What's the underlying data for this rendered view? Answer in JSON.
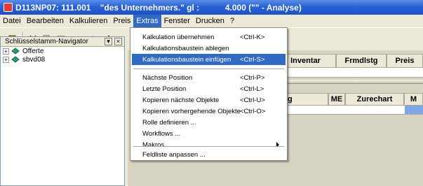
{
  "window": {
    "title": "D113NP07: 111.001    \"des Unternehmers.\" gl :           4.000 (\"\" - Analyse)"
  },
  "menubar": {
    "items": [
      {
        "label": "Datei"
      },
      {
        "label": "Bearbeiten"
      },
      {
        "label": "Kalkulieren"
      },
      {
        "label": "Preis"
      },
      {
        "label": "Extras"
      },
      {
        "label": "Fenster"
      },
      {
        "label": "Drucken"
      },
      {
        "label": "?"
      }
    ]
  },
  "navigator": {
    "title": "Schlüsselstamm-Navigator",
    "tree": [
      {
        "label": "Offerte"
      },
      {
        "label": "sbvd08"
      }
    ]
  },
  "columns_top": [
    {
      "label": "Inventar"
    },
    {
      "label": "Frmdlstg"
    },
    {
      "label": "Preis"
    }
  ],
  "columns_bottom": [
    {
      "label": "ig"
    },
    {
      "label": "ME"
    },
    {
      "label": "Zurechart"
    },
    {
      "label": "M"
    }
  ],
  "extras_menu": {
    "items": [
      {
        "label": "Kalkulation übernehmen",
        "shortcut": "<Ctrl-K>"
      },
      {
        "label": "Kalkulationsbaustein ablegen",
        "shortcut": ""
      },
      {
        "label": "Kalkulationsbaustein einfügen",
        "shortcut": "<Ctrl-S>"
      },
      {
        "label": "Nächste Position",
        "shortcut": "<Ctrl-P>"
      },
      {
        "label": "Letzte Position",
        "shortcut": "<Ctrl-L>"
      },
      {
        "label": "Kopieren nächste Objekte",
        "shortcut": "<Ctrl-U>"
      },
      {
        "label": "Kopieren vorhergehende Objekte",
        "shortcut": "<Ctrl-O>"
      },
      {
        "label": "Rolle definieren ...",
        "shortcut": ""
      },
      {
        "label": "Workflows ...",
        "shortcut": ""
      },
      {
        "label": "Makros",
        "shortcut": ""
      },
      {
        "label": "Feldliste anpassen ...",
        "shortcut": ""
      }
    ],
    "highlighted_label": "Kalkulationsbaustein einfügen"
  },
  "colors": {
    "titlebar": "#2a62d6",
    "highlight": "#316ac5",
    "menu_bg": "#ece9d8"
  }
}
